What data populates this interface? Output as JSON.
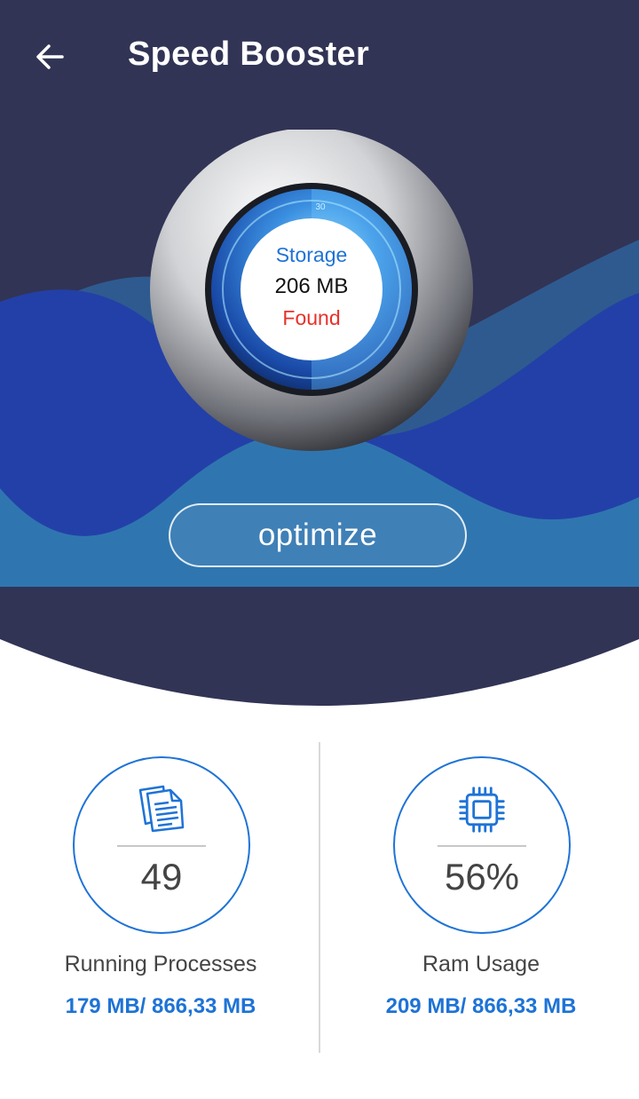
{
  "app_bar": {
    "title": "Speed Booster",
    "back_icon": "arrow-left-icon"
  },
  "gauge": {
    "label": "Storage",
    "value": "206 MB",
    "status": "Found",
    "tick_label": "30"
  },
  "optimize": {
    "label": "optimize"
  },
  "stats": {
    "processes": {
      "icon": "document-icon",
      "value": "49",
      "title": "Running Processes",
      "usage": "179 MB/ 866,33 MB"
    },
    "ram": {
      "icon": "cpu-chip-icon",
      "value": "56%",
      "title": "Ram Usage",
      "usage": "209 MB/ 866,33 MB"
    }
  },
  "colors": {
    "navy": "#313455",
    "wave_blue": "#2340a8",
    "wave_teal": "#2f76b0",
    "accent_blue": "#1e73d6",
    "found_red": "#e8302a"
  }
}
